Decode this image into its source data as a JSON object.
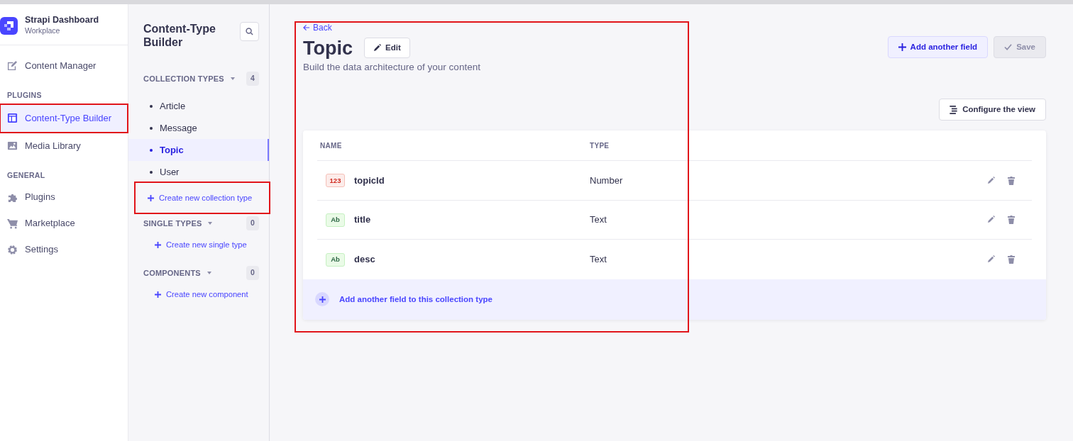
{
  "brand": {
    "title": "Strapi Dashboard",
    "subtitle": "Workplace"
  },
  "nav": [
    {
      "kind": "item",
      "label": "Content Manager",
      "selected": false,
      "highlighted": false
    },
    {
      "kind": "section",
      "label": "PLUGINS"
    },
    {
      "kind": "item",
      "label": "Content-Type Builder",
      "selected": true,
      "highlighted": true
    },
    {
      "kind": "item",
      "label": "Media Library",
      "selected": false,
      "highlighted": false
    },
    {
      "kind": "section",
      "label": "GENERAL"
    },
    {
      "kind": "item",
      "label": "Plugins",
      "selected": false,
      "highlighted": false
    },
    {
      "kind": "item",
      "label": "Marketplace",
      "selected": false,
      "highlighted": false
    },
    {
      "kind": "item",
      "label": "Settings",
      "selected": false,
      "highlighted": false
    }
  ],
  "builder": {
    "title": "Content-Type Builder",
    "groups": [
      {
        "label": "COLLECTION TYPES",
        "count": "4",
        "items": [
          {
            "label": "Article",
            "selected": false
          },
          {
            "label": "Message",
            "selected": false
          },
          {
            "label": "Topic",
            "selected": true
          },
          {
            "label": "User",
            "selected": false
          }
        ],
        "create": {
          "label": "Create new collection type",
          "highlighted": true
        }
      },
      {
        "label": "SINGLE TYPES",
        "count": "0",
        "create": {
          "label": "Create new single type",
          "highlighted": false
        }
      },
      {
        "label": "COMPONENTS",
        "count": "0",
        "create": {
          "label": "Create new component",
          "highlighted": false
        }
      }
    ]
  },
  "header": {
    "back": "Back",
    "title": "Topic",
    "edit": "Edit",
    "subtitle": "Build the data architecture of your content",
    "highlighted": true,
    "add_button": "Add another field",
    "save_button": "Save",
    "save_disabled": true,
    "configure_button": "Configure the view"
  },
  "table": {
    "columns": [
      "NAME",
      "TYPE"
    ],
    "rows": [
      {
        "kind": "number",
        "badge": "123",
        "name": "topicId",
        "type": "Number"
      },
      {
        "kind": "text",
        "badge": "Ab",
        "name": "title",
        "type": "Text"
      },
      {
        "kind": "text",
        "badge": "Ab",
        "name": "desc",
        "type": "Text"
      }
    ],
    "add_footer": "Add another field to this collection type"
  }
}
